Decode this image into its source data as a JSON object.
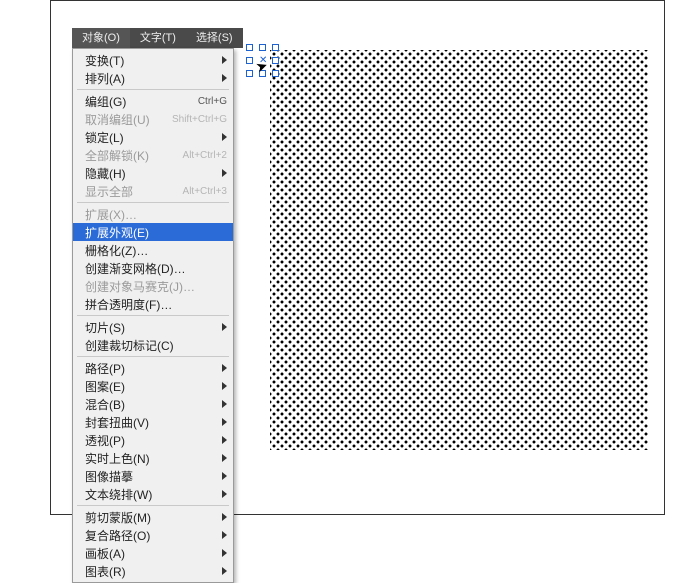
{
  "menubar": {
    "items": [
      {
        "label": "对象(O)"
      },
      {
        "label": "文字(T)"
      },
      {
        "label": "选择(S)"
      }
    ]
  },
  "dropdown": {
    "groups": [
      [
        {
          "label": "变换(T)",
          "submenu": true
        },
        {
          "label": "排列(A)",
          "submenu": true
        }
      ],
      [
        {
          "label": "编组(G)",
          "shortcut": "Ctrl+G"
        },
        {
          "label": "取消编组(U)",
          "shortcut": "Shift+Ctrl+G",
          "disabled": true
        },
        {
          "label": "锁定(L)",
          "submenu": true
        },
        {
          "label": "全部解锁(K)",
          "shortcut": "Alt+Ctrl+2",
          "disabled": true
        },
        {
          "label": "隐藏(H)",
          "submenu": true
        },
        {
          "label": "显示全部",
          "shortcut": "Alt+Ctrl+3",
          "disabled": true
        }
      ],
      [
        {
          "label": "扩展(X)…",
          "disabled": true
        },
        {
          "label": "扩展外观(E)",
          "highlight": true
        },
        {
          "label": "栅格化(Z)…"
        },
        {
          "label": "创建渐变网格(D)…"
        },
        {
          "label": "创建对象马赛克(J)…",
          "disabled": true
        },
        {
          "label": "拼合透明度(F)…"
        }
      ],
      [
        {
          "label": "切片(S)",
          "submenu": true
        },
        {
          "label": "创建裁切标记(C)"
        }
      ],
      [
        {
          "label": "路径(P)",
          "submenu": true
        },
        {
          "label": "图案(E)",
          "submenu": true
        },
        {
          "label": "混合(B)",
          "submenu": true
        },
        {
          "label": "封套扭曲(V)",
          "submenu": true
        },
        {
          "label": "透视(P)",
          "submenu": true
        },
        {
          "label": "实时上色(N)",
          "submenu": true
        },
        {
          "label": "图像描摹",
          "submenu": true
        },
        {
          "label": "文本绕排(W)",
          "submenu": true
        }
      ],
      [
        {
          "label": "剪切蒙版(M)",
          "submenu": true
        },
        {
          "label": "复合路径(O)",
          "submenu": true
        },
        {
          "label": "画板(A)",
          "submenu": true
        },
        {
          "label": "图表(R)",
          "submenu": true
        }
      ]
    ]
  }
}
